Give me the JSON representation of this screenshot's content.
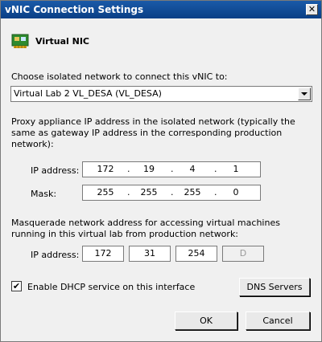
{
  "window": {
    "title": "vNIC Connection Settings",
    "close_glyph": "✕"
  },
  "header": {
    "title": "Virtual NIC",
    "icon": "network-card-icon"
  },
  "network": {
    "label": "Choose isolated network to connect this vNIC to:",
    "selected": "Virtual Lab 2 VL_DESA (VL_DESA)"
  },
  "proxy": {
    "description": "Proxy appliance IP address in the isolated network (typically the same as gateway IP address in the corresponding production network):",
    "ip_label": "IP address:",
    "ip": [
      "172",
      "19",
      "4",
      "1"
    ],
    "mask_label": "Mask:",
    "mask": [
      "255",
      "255",
      "255",
      "0"
    ]
  },
  "masquerade": {
    "description": "Masquerade network address for accessing virtual machines running in this virtual lab from production network:",
    "ip_label": "IP address:",
    "ip": [
      "172",
      "31",
      "254",
      "D"
    ]
  },
  "dhcp": {
    "label": "Enable DHCP service on this interface",
    "checked": true
  },
  "buttons": {
    "dns": "DNS Servers",
    "ok": "OK",
    "cancel": "Cancel"
  }
}
